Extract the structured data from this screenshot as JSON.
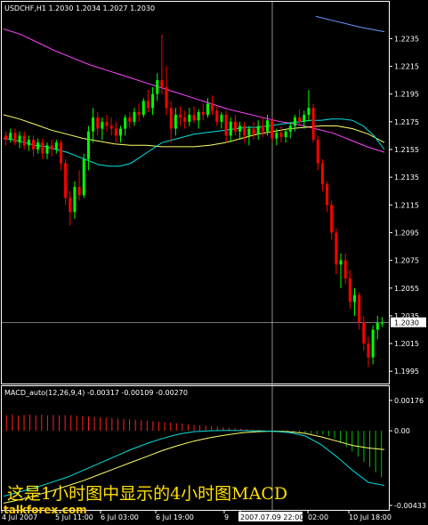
{
  "header": {
    "main_title": "USDCHF,H1  1.2030 1.2034 1.2027 1.2030",
    "macd_title": "MACD_auto(12,26,9,4) -0.00317 -0.00109 -0.00270"
  },
  "overlay_text": "这是1小时图中显示的4小时图MACD",
  "watermark": "talkforex.com",
  "colors": {
    "bull": "#00ff00",
    "bear": "#ff0000",
    "ma_fast": "#00e0e0",
    "ma_slow": "#ffff66",
    "ma_long": "#ff44ff",
    "ma_blue": "#6699ff",
    "hist_pos": "#ff2020",
    "hist_neg": "#00c000",
    "axis": "#ffffff"
  },
  "chart_data": {
    "type": "candlestick",
    "symbol": "USDCHF",
    "timeframe": "H1",
    "price_axis": {
      "ticks": [
        "1.2235",
        "1.2215",
        "1.2195",
        "1.2175",
        "1.2155",
        "1.2135",
        "1.2115",
        "1.2095",
        "1.2075",
        "1.2055",
        "1.2035",
        "1.2015",
        "1.1995"
      ],
      "current": "1.2030",
      "min": 1.199,
      "max": 1.225
    },
    "time_axis": [
      "4 Jul 2007",
      "5 Jul 11:00",
      "6 Jul 03:00",
      "6 Jul 19:00",
      "9",
      "2007.07.09 22:00",
      "02:00",
      "10 Jul 18:00"
    ],
    "candles": [
      [
        1.2165,
        1.2168,
        1.2158,
        1.2162
      ],
      [
        1.2162,
        1.217,
        1.216,
        1.2167
      ],
      [
        1.2167,
        1.217,
        1.2158,
        1.216
      ],
      [
        1.216,
        1.2168,
        1.2156,
        1.2165
      ],
      [
        1.2165,
        1.2168,
        1.2155,
        1.2158
      ],
      [
        1.2158,
        1.2165,
        1.2154,
        1.2162
      ],
      [
        1.2162,
        1.2165,
        1.215,
        1.2155
      ],
      [
        1.2155,
        1.2163,
        1.2152,
        1.216
      ],
      [
        1.216,
        1.2163,
        1.2148,
        1.2152
      ],
      [
        1.2152,
        1.216,
        1.2148,
        1.2158
      ],
      [
        1.2158,
        1.2162,
        1.215,
        1.2155
      ],
      [
        1.2155,
        1.2162,
        1.2152,
        1.216
      ],
      [
        1.216,
        1.2162,
        1.214,
        1.2145
      ],
      [
        1.2145,
        1.2148,
        1.2115,
        1.212
      ],
      [
        1.212,
        1.2125,
        1.21,
        1.211
      ],
      [
        1.211,
        1.2132,
        1.2105,
        1.2128
      ],
      [
        1.2128,
        1.214,
        1.2118,
        1.2122
      ],
      [
        1.2122,
        1.2152,
        1.212,
        1.2148
      ],
      [
        1.2148,
        1.2172,
        1.214,
        1.2168
      ],
      [
        1.2168,
        1.2185,
        1.216,
        1.2178
      ],
      [
        1.2178,
        1.2182,
        1.2165,
        1.217
      ],
      [
        1.217,
        1.2178,
        1.2162,
        1.2175
      ],
      [
        1.2175,
        1.218,
        1.2168,
        1.2172
      ],
      [
        1.2172,
        1.2178,
        1.2165,
        1.217
      ],
      [
        1.217,
        1.2175,
        1.216,
        1.2165
      ],
      [
        1.2165,
        1.2172,
        1.216,
        1.217
      ],
      [
        1.217,
        1.218,
        1.2165,
        1.2178
      ],
      [
        1.2178,
        1.2182,
        1.217,
        1.2175
      ],
      [
        1.2175,
        1.2185,
        1.2172,
        1.2182
      ],
      [
        1.2182,
        1.2188,
        1.2175,
        1.218
      ],
      [
        1.218,
        1.2192,
        1.2178,
        1.219
      ],
      [
        1.219,
        1.2198,
        1.2182,
        1.2185
      ],
      [
        1.2185,
        1.22,
        1.218,
        1.2195
      ],
      [
        1.2195,
        1.221,
        1.219,
        1.2205
      ],
      [
        1.2205,
        1.2238,
        1.2195,
        1.22
      ],
      [
        1.22,
        1.2215,
        1.218,
        1.2185
      ],
      [
        1.2185,
        1.219,
        1.216,
        1.217
      ],
      [
        1.217,
        1.2185,
        1.2165,
        1.218
      ],
      [
        1.218,
        1.2186,
        1.2172,
        1.2178
      ],
      [
        1.2178,
        1.2183,
        1.217,
        1.2175
      ],
      [
        1.2175,
        1.2185,
        1.2172,
        1.218
      ],
      [
        1.218,
        1.2186,
        1.2174,
        1.2176
      ],
      [
        1.2176,
        1.2184,
        1.217,
        1.2182
      ],
      [
        1.2182,
        1.2188,
        1.2176,
        1.218
      ],
      [
        1.218,
        1.2192,
        1.2178,
        1.2188
      ],
      [
        1.2188,
        1.2194,
        1.218,
        1.2183
      ],
      [
        1.2183,
        1.2186,
        1.2172,
        1.2175
      ],
      [
        1.2175,
        1.2182,
        1.217,
        1.218
      ],
      [
        1.218,
        1.2183,
        1.216,
        1.2165
      ],
      [
        1.2165,
        1.2178,
        1.216,
        1.2175
      ],
      [
        1.2175,
        1.218,
        1.2165,
        1.2168
      ],
      [
        1.2168,
        1.2175,
        1.2162,
        1.2172
      ],
      [
        1.2172,
        1.2175,
        1.216,
        1.2165
      ],
      [
        1.2165,
        1.2172,
        1.2158,
        1.217
      ],
      [
        1.217,
        1.2175,
        1.2162,
        1.2166
      ],
      [
        1.2166,
        1.2176,
        1.2162,
        1.2172
      ],
      [
        1.2172,
        1.2178,
        1.2164,
        1.2168
      ],
      [
        1.2168,
        1.218,
        1.2165,
        1.2176
      ],
      [
        1.2176,
        1.2178,
        1.216,
        1.2163
      ],
      [
        1.2163,
        1.217,
        1.2158,
        1.2167
      ],
      [
        1.2167,
        1.2172,
        1.216,
        1.2164
      ],
      [
        1.2164,
        1.217,
        1.216,
        1.2168
      ],
      [
        1.2168,
        1.2175,
        1.2163,
        1.2172
      ],
      [
        1.2172,
        1.218,
        1.2168,
        1.2178
      ],
      [
        1.2178,
        1.2184,
        1.2172,
        1.2175
      ],
      [
        1.2175,
        1.2183,
        1.217,
        1.218
      ],
      [
        1.218,
        1.2198,
        1.2175,
        1.2185
      ],
      [
        1.2185,
        1.2188,
        1.216,
        1.2162
      ],
      [
        1.2162,
        1.2165,
        1.214,
        1.2145
      ],
      [
        1.2145,
        1.2148,
        1.2125,
        1.213
      ],
      [
        1.213,
        1.2132,
        1.211,
        1.2115
      ],
      [
        1.2115,
        1.2118,
        1.209,
        1.2095
      ],
      [
        1.2095,
        1.2098,
        1.2065,
        1.2072
      ],
      [
        1.2072,
        1.208,
        1.2055,
        1.2075
      ],
      [
        1.2075,
        1.208,
        1.2058,
        1.2062
      ],
      [
        1.2062,
        1.2068,
        1.204,
        1.2045
      ],
      [
        1.2045,
        1.2055,
        1.2035,
        1.205
      ],
      [
        1.205,
        1.2052,
        1.2025,
        1.203
      ],
      [
        1.203,
        1.2035,
        1.201,
        1.2015
      ],
      [
        1.2015,
        1.202,
        1.1998,
        1.2005
      ],
      [
        1.2005,
        1.2028,
        1.2,
        1.2025
      ],
      [
        1.2025,
        1.2035,
        1.2018,
        1.203
      ],
      [
        1.203,
        1.2034,
        1.2027,
        1.203
      ]
    ],
    "ma_fast": [
      1.2163,
      1.2162,
      1.216,
      1.2158,
      1.2157,
      1.2155,
      1.2153,
      1.215,
      1.2147,
      1.2144,
      1.2143,
      1.2143,
      1.2145,
      1.215,
      1.2155,
      1.216,
      1.2162,
      1.2164,
      1.2166,
      1.2167,
      1.2168,
      1.2169,
      1.217,
      1.2171,
      1.2171,
      1.2172,
      1.2173,
      1.2174,
      1.2175,
      1.2176,
      1.2176,
      1.2177,
      1.2177,
      1.2176,
      1.2172,
      1.2165,
      1.2155
    ],
    "ma_slow": [
      1.218,
      1.2177,
      1.2173,
      1.2169,
      1.2166,
      1.2163,
      1.2161,
      1.2159,
      1.2158,
      1.2158,
      1.2157,
      1.2157,
      1.2157,
      1.2158,
      1.216,
      1.2163,
      1.2166,
      1.2168,
      1.217,
      1.2171,
      1.2172,
      1.2172,
      1.217,
      1.2166,
      1.216
    ],
    "ma_long": [
      1.2242,
      1.2238,
      1.2232,
      1.2226,
      1.2221,
      1.2216,
      1.2212,
      1.2208,
      1.2204,
      1.22,
      1.2196,
      1.2192,
      1.2188,
      1.2184,
      1.2181,
      1.2178,
      1.2175,
      1.2173,
      1.217,
      1.2167,
      1.2162,
      1.2157,
      1.2153
    ],
    "ma_blue": [
      1.2251,
      1.2247,
      1.2243,
      1.224
    ],
    "macd": {
      "axis_ticks": [
        "0.00176",
        "0.00",
        "-0.00433"
      ],
      "max": 0.00176,
      "min": -0.00433,
      "histogram": [
        0.0009,
        0.00095,
        0.00088,
        0.00092,
        0.00094,
        0.0009,
        0.00093,
        0.00089,
        0.00092,
        0.0009,
        0.00091,
        0.0009,
        0.00088,
        0.00086,
        0.00082,
        0.0008,
        0.00078,
        0.00076,
        0.00074,
        0.00071,
        0.00069,
        0.00066,
        0.00064,
        0.00061,
        0.00058,
        0.00055,
        0.00052,
        0.0005,
        0.00047,
        0.00044,
        0.00041,
        0.00038,
        0.00035,
        0.00032,
        0.0003,
        0.00027,
        0.00024,
        0.00021,
        0.00018,
        0.00015,
        0.00012,
        0.0001,
        8e-05,
        5e-05,
        3e-05,
        -1e-05,
        -3e-05,
        -5e-05,
        -8e-05,
        -0.0001,
        -0.00012,
        -0.00015,
        -0.00018,
        -0.0002,
        -0.00022,
        -0.0003,
        -0.00045,
        -0.0007,
        -0.00095,
        -0.0012,
        -0.0015,
        -0.0018,
        -0.0021,
        -0.0024,
        -0.0027
      ],
      "macd_line": [
        -0.0038,
        -0.00355,
        -0.0033,
        -0.003,
        -0.0027,
        -0.0023,
        -0.0019,
        -0.0015,
        -0.0011,
        -0.00075,
        -0.00045,
        -0.0002,
        -5e-05,
        0.0,
        2e-05,
        1e-05,
        0.0,
        -3e-05,
        -0.0001,
        -0.0003,
        -0.0008,
        -0.0015,
        -0.0023,
        -0.003,
        -0.00317
      ],
      "signal_line": [
        -0.0042,
        -0.004,
        -0.00375,
        -0.0035,
        -0.0032,
        -0.0029,
        -0.00255,
        -0.0022,
        -0.00185,
        -0.0015,
        -0.00115,
        -0.00085,
        -0.0006,
        -0.0004,
        -0.00025,
        -0.00012,
        -5e-05,
        -2e-05,
        -5e-05,
        -0.00015,
        -0.00035,
        -0.0006,
        -0.00085,
        -0.001,
        -0.00109
      ]
    }
  }
}
